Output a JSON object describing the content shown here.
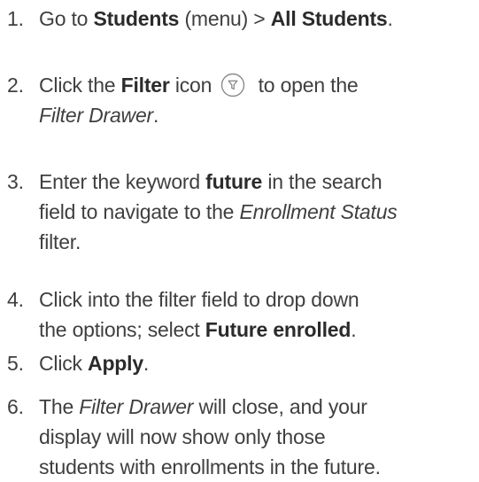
{
  "steps": [
    {
      "num": "1.",
      "lines": [
        [
          "Go to ",
          {
            "b": "Students"
          },
          " (menu) > ",
          {
            "b": "All Students"
          },
          "."
        ]
      ]
    },
    {
      "num": "2.",
      "lines": [
        [
          "Click the ",
          {
            "b": "Filter"
          },
          " icon ",
          {
            "icon": "filter-icon"
          },
          " to open the"
        ],
        [
          {
            "i": "Filter Drawer"
          },
          "."
        ]
      ]
    },
    {
      "num": "3.",
      "lines": [
        [
          "Enter the keyword ",
          {
            "b": "future"
          },
          " in the search"
        ],
        [
          "field to navigate to the ",
          {
            "i": "Enrollment Status"
          }
        ],
        [
          "filter."
        ]
      ]
    },
    {
      "num": "4.",
      "lines": [
        [
          "Click into the filter field to drop down"
        ],
        [
          "the options; select ",
          {
            "b": "Future enrolled"
          },
          "."
        ]
      ]
    },
    {
      "num": "5.",
      "lines": [
        [
          "Click ",
          {
            "b": "Apply"
          },
          "."
        ]
      ]
    },
    {
      "num": "6.",
      "lines": [
        [
          "The ",
          {
            "i": "Filter Drawer"
          },
          " will close, and your"
        ],
        [
          "display will now show only those"
        ],
        [
          "students with enrollments in the future."
        ]
      ]
    }
  ],
  "icon_color": "#8a8a8a"
}
